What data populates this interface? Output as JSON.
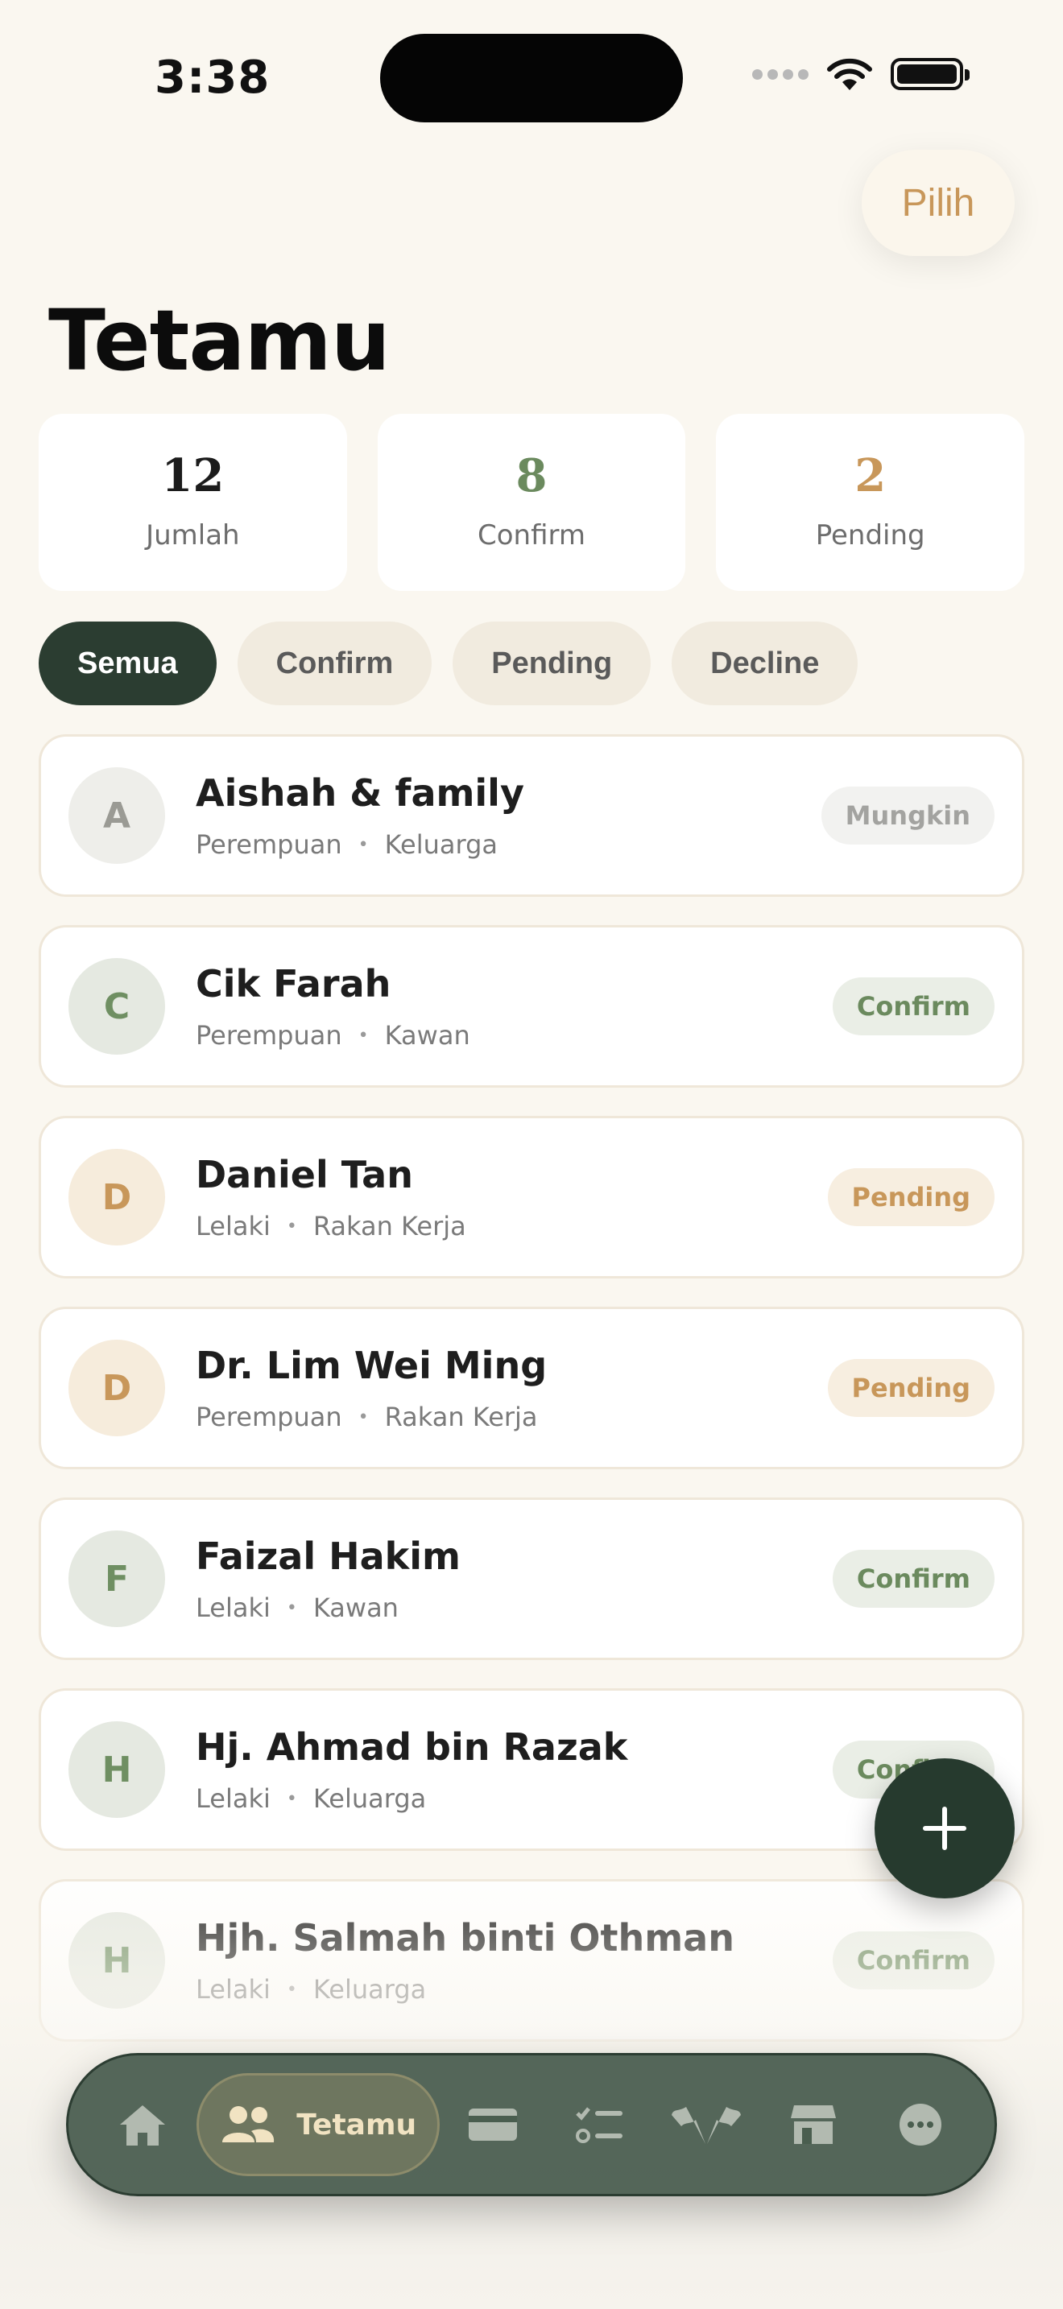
{
  "status_bar": {
    "time": "3:38"
  },
  "header": {
    "select_button": "Pilih",
    "title": "Tetamu"
  },
  "stats": [
    {
      "value": "12",
      "label": "Jumlah",
      "color": "#1c1c1c"
    },
    {
      "value": "8",
      "label": "Confirm",
      "color": "#6b8a5e"
    },
    {
      "value": "2",
      "label": "Pending",
      "color": "#c8975a"
    }
  ],
  "filters": [
    "Semua",
    "Confirm",
    "Pending",
    "Decline"
  ],
  "guests": [
    {
      "initial": "A",
      "name": "Aishah & family",
      "gender": "Perempuan",
      "group": "Keluarga",
      "status": "Mungkin"
    },
    {
      "initial": "C",
      "name": "Cik Farah",
      "gender": "Perempuan",
      "group": "Kawan",
      "status": "Confirm"
    },
    {
      "initial": "D",
      "name": "Daniel Tan",
      "gender": "Lelaki",
      "group": "Rakan Kerja",
      "status": "Pending"
    },
    {
      "initial": "D",
      "name": "Dr. Lim Wei Ming",
      "gender": "Perempuan",
      "group": "Rakan Kerja",
      "status": "Pending"
    },
    {
      "initial": "F",
      "name": "Faizal Hakim",
      "gender": "Lelaki",
      "group": "Kawan",
      "status": "Confirm"
    },
    {
      "initial": "H",
      "name": "Hj. Ahmad bin Razak",
      "gender": "Lelaki",
      "group": "Keluarga",
      "status": "Confirm"
    },
    {
      "initial": "H",
      "name": "Hjh. Salmah binti Othman",
      "gender": "Lelaki",
      "group": "Keluarga",
      "status": "Confirm"
    }
  ],
  "tabbar": {
    "items": [
      {
        "icon": "home-icon"
      },
      {
        "icon": "people-icon",
        "label": "Tetamu",
        "active": true
      },
      {
        "icon": "card-icon"
      },
      {
        "icon": "checklist-icon"
      },
      {
        "icon": "flags-icon"
      },
      {
        "icon": "store-icon"
      },
      {
        "icon": "more-icon"
      }
    ]
  },
  "colors": {
    "accent_dark": "#2b3d31",
    "gold": "#c8975a",
    "green": "#6b8a5e",
    "background": "#faf7f0"
  }
}
